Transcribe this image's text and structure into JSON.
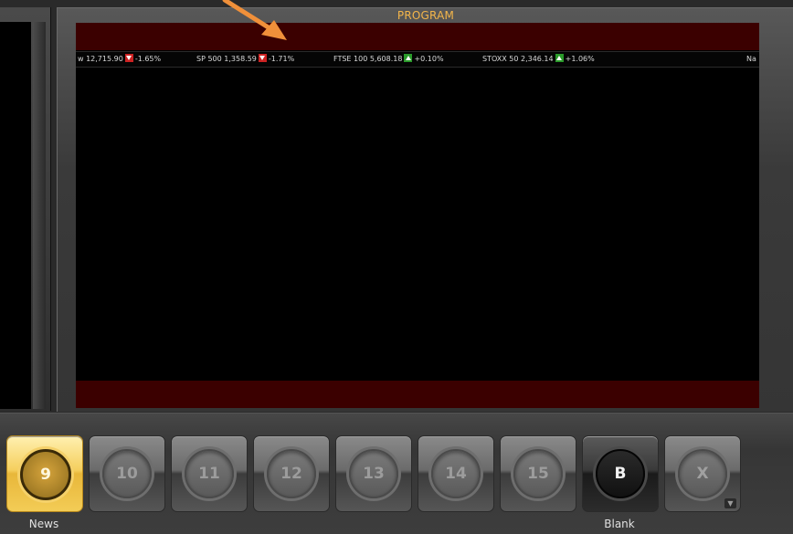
{
  "program_panel": {
    "title": "PROGRAM"
  },
  "ticker": {
    "items": [
      {
        "name": "w 12,715.90",
        "change": "-1.65%",
        "direction": "down"
      },
      {
        "name": "SP 500 1,358.59",
        "change": "-1.71%",
        "direction": "down"
      },
      {
        "name": "FTSE 100 5,608.18",
        "change": "+0.10%",
        "direction": "up"
      },
      {
        "name": "STOXX 50 2,346.14",
        "change": "+1.06%",
        "direction": "up"
      },
      {
        "name": "Na",
        "change": "",
        "direction": ""
      }
    ]
  },
  "inputs": {
    "buttons": [
      {
        "label": "9",
        "caption": "News",
        "state": "active"
      },
      {
        "label": "10",
        "caption": "",
        "state": "normal"
      },
      {
        "label": "11",
        "caption": "",
        "state": "normal"
      },
      {
        "label": "12",
        "caption": "",
        "state": "normal"
      },
      {
        "label": "13",
        "caption": "",
        "state": "normal"
      },
      {
        "label": "14",
        "caption": "",
        "state": "normal"
      },
      {
        "label": "15",
        "caption": "",
        "state": "normal"
      },
      {
        "label": "B",
        "caption": "Blank",
        "state": "dark"
      },
      {
        "label": "X",
        "caption": "",
        "state": "normal"
      }
    ]
  },
  "colors": {
    "program_title": "#f3b54a",
    "annotation_arrow": "#f0903a",
    "active_button": "#f5cf5e",
    "ticker_down": "#cc2222",
    "ticker_up": "#2a9a2a",
    "red_band": "#3b0000"
  },
  "icons": {
    "annotation": "arrow-down-right-icon",
    "dropdown": "chevron-down-icon"
  }
}
